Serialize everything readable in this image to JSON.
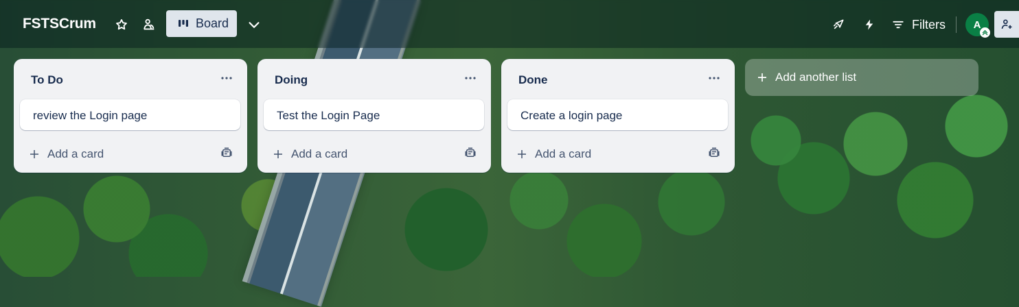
{
  "colors": {
    "topbar_overlay": "#12322f",
    "board_button_bg": "#dfe5ec",
    "avatar_bg": "#0a7f45",
    "list_bg": "#f1f2f4",
    "card_bg": "#ffffff",
    "primary_text": "#172b4d",
    "secondary_text": "#44546f"
  },
  "header": {
    "board_title": "FSTSCrum",
    "view_button": "Board",
    "filters_label": "Filters",
    "avatar_initial": "A",
    "icons": {
      "star": "star-icon",
      "visibility": "team-visibility-icon",
      "view_dropdown": "chevron-down-icon",
      "power_ups": "rocket-icon",
      "automation": "lightning-icon",
      "filters": "filter-icon",
      "share": "add-user-icon"
    }
  },
  "lists": [
    {
      "title": "To Do",
      "cards": [
        {
          "title": "review the Login page"
        }
      ],
      "add_card_label": "Add a card"
    },
    {
      "title": "Doing",
      "cards": [
        {
          "title": "Test the Login Page"
        }
      ],
      "add_card_label": "Add a card"
    },
    {
      "title": "Done",
      "cards": [
        {
          "title": "Create a login page"
        }
      ],
      "add_card_label": "Add a card"
    }
  ],
  "add_list": {
    "label": "Add another list"
  }
}
